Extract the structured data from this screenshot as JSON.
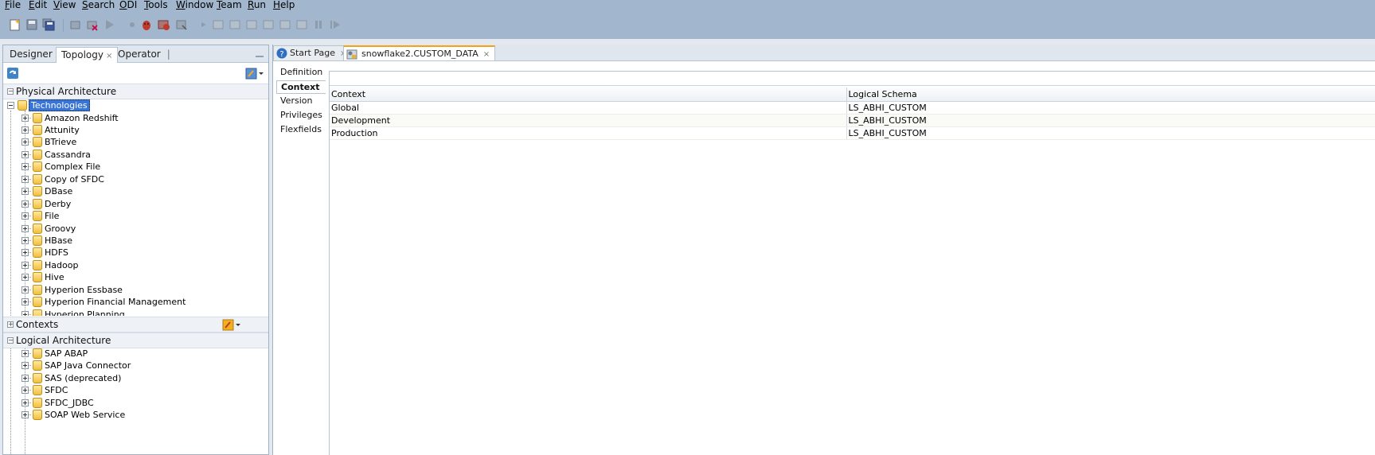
{
  "menu": [
    "File",
    "Edit",
    "View",
    "Search",
    "ODI",
    "Tools",
    "Window",
    "Team",
    "Run",
    "Help"
  ],
  "toolbar_icons": [
    "new-icon",
    "save-icon",
    "save-all-icon",
    "undo-icon",
    "delete-icon",
    "run-icon",
    "dot-icon",
    "debug-icon",
    "debug-alt-icon",
    "remove-icon",
    "step-icon",
    "step-into-icon",
    "step-over-icon",
    "step-out-icon",
    "step-back-icon",
    "pause-icon",
    "resume-icon"
  ],
  "nav_tabs": {
    "designer": "Designer",
    "topology": "Topology",
    "operator": "Operator"
  },
  "physical_architecture": {
    "label": "Physical Architecture",
    "root": "Technologies",
    "items": [
      "Amazon Redshift",
      "Attunity",
      "BTrieve",
      "Cassandra",
      "Complex File",
      "Copy of SFDC",
      "DBase",
      "Derby",
      "File",
      "Groovy",
      "HBase",
      "HDFS",
      "Hadoop",
      "Hive",
      "Hyperion Essbase",
      "Hyperion Financial Management",
      "Hyperion Planning"
    ]
  },
  "contexts": {
    "label": "Contexts"
  },
  "logical_architecture": {
    "label": "Logical Architecture",
    "items": [
      "SAP ABAP",
      "SAP Java Connector",
      "SAS (deprecated)",
      "SFDC",
      "SFDC_JDBC",
      "SOAP Web Service"
    ]
  },
  "editor_tabs": {
    "start": "Start Page",
    "active": "snowflake2.CUSTOM_DATA"
  },
  "side_tabs": {
    "definition": "Definition",
    "context": "Context",
    "version": "Version",
    "privileges": "Privileges",
    "flexfields": "Flexfields"
  },
  "context_table": {
    "headers": {
      "context": "Context",
      "schema": "Logical Schema"
    },
    "rows": [
      {
        "context": "Global",
        "schema": "LS_ABHI_CUSTOM"
      },
      {
        "context": "Development",
        "schema": "LS_ABHI_CUSTOM"
      },
      {
        "context": "Production",
        "schema": "LS_ABHI_CUSTOM"
      }
    ]
  },
  "colors": {
    "chrome": "#a2b6cd",
    "selection": "#3875d7",
    "tab_accent": "#f3a21a"
  }
}
